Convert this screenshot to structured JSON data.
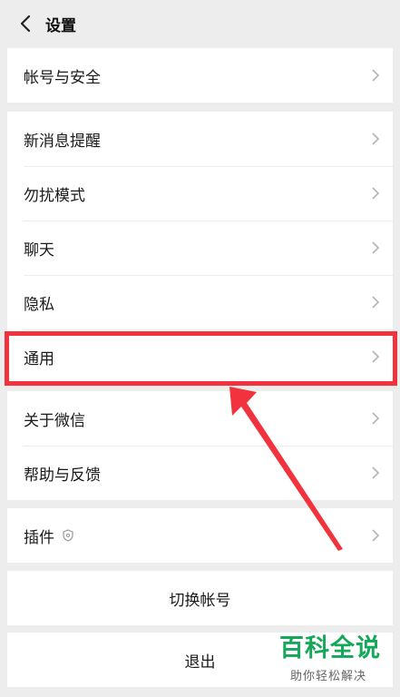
{
  "header": {
    "title": "设置"
  },
  "groups": [
    {
      "items": [
        {
          "label": "帐号与安全"
        }
      ]
    },
    {
      "items": [
        {
          "label": "新消息提醒"
        },
        {
          "label": "勿扰模式"
        },
        {
          "label": "聊天"
        },
        {
          "label": "隐私"
        },
        {
          "label": "通用"
        }
      ]
    },
    {
      "items": [
        {
          "label": "关于微信"
        },
        {
          "label": "帮助与反馈"
        }
      ]
    },
    {
      "items": [
        {
          "label": "插件"
        }
      ]
    }
  ],
  "actions": {
    "switch_account": "切换帐号",
    "logout": "退出"
  },
  "annotation": {
    "highlight_color": "#f2323c",
    "highlighted_item": "通用"
  },
  "watermark": {
    "main": "百科全说",
    "sub": "助你轻松解决"
  }
}
